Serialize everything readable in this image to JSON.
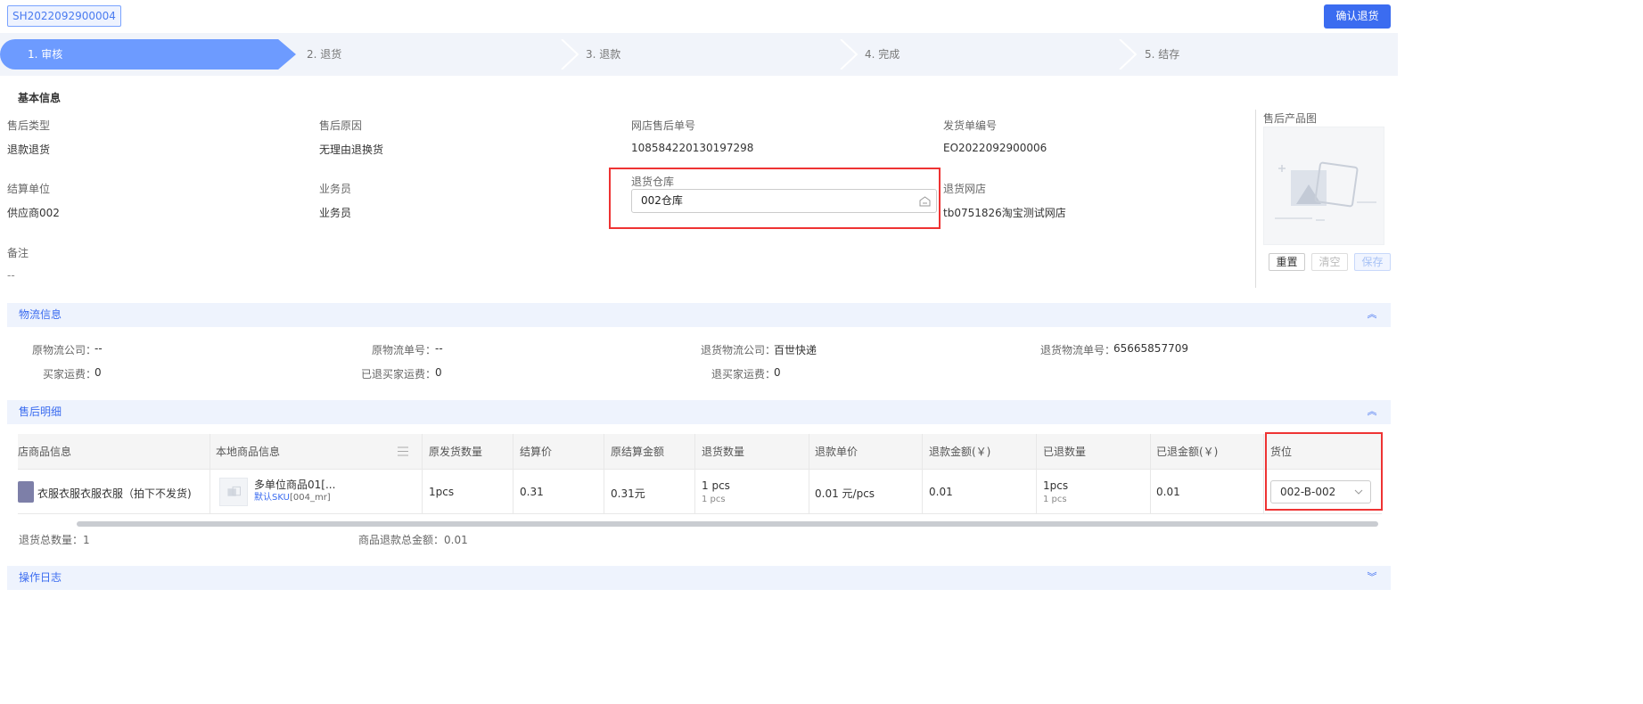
{
  "header": {
    "order_no": "SH2022092900004",
    "confirm_label": "确认退货"
  },
  "steps": [
    {
      "label": "1. 审核",
      "active": true
    },
    {
      "label": "2. 退货",
      "active": false
    },
    {
      "label": "3. 退款",
      "active": false
    },
    {
      "label": "4. 完成",
      "active": false
    },
    {
      "label": "5. 结存",
      "active": false
    }
  ],
  "basic_info": {
    "title": "基本信息",
    "after_sale_type": {
      "label": "售后类型",
      "value": "退款退货"
    },
    "reason": {
      "label": "售后原因",
      "value": "无理由退换货"
    },
    "shop_order_no": {
      "label": "网店售后单号",
      "value": "108584220130197298"
    },
    "delivery_no": {
      "label": "发货单编号",
      "value": "EO2022092900006"
    },
    "settlement_unit": {
      "label": "结算单位",
      "value": "供应商002"
    },
    "salesperson": {
      "label": "业务员",
      "value": "业务员"
    },
    "return_warehouse": {
      "label": "退货仓库",
      "value": "002仓库"
    },
    "return_shop": {
      "label": "退货网店",
      "value": "tb0751826淘宝测试网店"
    },
    "remark": {
      "label": "备注",
      "value": "--"
    }
  },
  "product_image": {
    "label": "售后产品图",
    "reset": "重置",
    "clear": "清空",
    "save": "保存"
  },
  "logistics": {
    "title": "物流信息",
    "orig_company": {
      "label": "原物流公司：",
      "value": "--"
    },
    "orig_no": {
      "label": "原物流单号：",
      "value": "--"
    },
    "return_company": {
      "label": "退货物流公司：",
      "value": "百世快递"
    },
    "return_no": {
      "label": "退货物流单号：",
      "value": "65665857709"
    },
    "buyer_freight": {
      "label": "买家运费：",
      "value": "0"
    },
    "refunded_buyer_freight": {
      "label": "已退买家运费：",
      "value": "0"
    },
    "refund_buyer_freight": {
      "label": "退买家运费：",
      "value": "0"
    }
  },
  "detail": {
    "title": "售后明细",
    "columns": [
      "店商品信息",
      "本地商品信息",
      "原发货数量",
      "结算价",
      "原结算金额",
      "退货数量",
      "退款单价",
      "退款金额(￥)",
      "已退数量",
      "已退金额(￥)",
      "货位"
    ],
    "row": {
      "shop_product": "衣服衣服衣服衣服（拍下不发货)",
      "local_product": "多单位商品01[...",
      "sku_link": "默认SKU",
      "sku_code": "[004_mr]",
      "orig_qty": "1pcs",
      "settle_price": "0.31",
      "orig_amount": "0.31元",
      "return_qty": "1 pcs",
      "return_qty_sub": "1 pcs",
      "refund_unit": "0.01 元/pcs",
      "refund_amount": "0.01",
      "refunded_qty": "1pcs",
      "refunded_qty_sub": "1 pcs",
      "refunded_amount": "0.01",
      "location": "002-B-002"
    },
    "total_qty": "退货总数量：1",
    "total_refund": "商品退款总金额：0.01"
  },
  "log": {
    "title": "操作日志"
  },
  "colors": {
    "accent": "#3b6cf0",
    "step_active": "#6d9bff",
    "highlight": "#e33333"
  }
}
